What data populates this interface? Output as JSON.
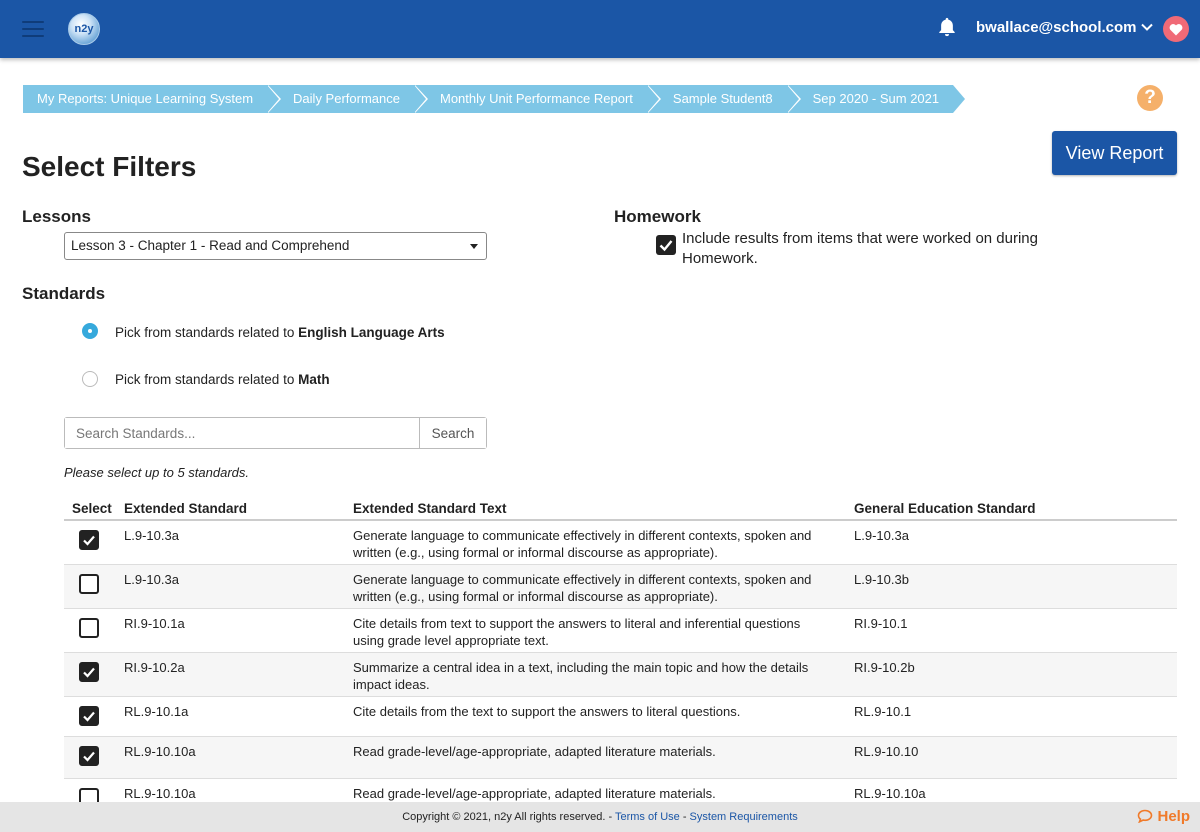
{
  "header": {
    "logo_text": "n2y",
    "user_email": "bwallace@school.com"
  },
  "breadcrumb": [
    "My Reports: Unique Learning System",
    "Daily Performance",
    "Monthly Unit Performance Report",
    "Sample Student8",
    "Sep 2020 - Sum 2021"
  ],
  "help_glyph": "?",
  "page_title": "Select Filters",
  "view_report_label": "View Report",
  "lessons": {
    "heading": "Lessons",
    "selected": "Lesson 3 - Chapter 1 - Read and Comprehend"
  },
  "homework": {
    "heading": "Homework",
    "checked": true,
    "label": "Include results from items that were worked on during Homework."
  },
  "standards": {
    "heading": "Standards",
    "options": [
      {
        "prefix": "Pick from standards related to ",
        "subject": "English Language Arts",
        "selected": true
      },
      {
        "prefix": "Pick from standards related to ",
        "subject": "Math",
        "selected": false
      }
    ],
    "search_placeholder": "Search Standards...",
    "search_button": "Search",
    "hint": "Please select up to 5 standards."
  },
  "table": {
    "headers": [
      "Select",
      "Extended Standard",
      "Extended Standard Text",
      "General Education Standard"
    ],
    "rows": [
      {
        "checked": true,
        "ext": "L.9-10.3a",
        "text": "Generate language to communicate effectively in different contexts, spoken and written (e.g., using formal or informal discourse as appropriate).",
        "gen": "L.9-10.3a"
      },
      {
        "checked": false,
        "ext": "L.9-10.3a",
        "text": "Generate language to communicate effectively in different contexts, spoken and written (e.g., using formal or informal discourse as appropriate).",
        "gen": "L.9-10.3b"
      },
      {
        "checked": false,
        "ext": "RI.9-10.1a",
        "text": "Cite details from text to support the answers to literal and inferential questions using grade level appropriate text.",
        "gen": "RI.9-10.1"
      },
      {
        "checked": true,
        "ext": "RI.9-10.2a",
        "text": "Summarize a central idea in a text, including the main topic and how the details impact ideas.",
        "gen": "RI.9-10.2b"
      },
      {
        "checked": true,
        "ext": "RL.9-10.1a",
        "text": "Cite details from the text to support the answers to literal questions.",
        "gen": "RL.9-10.1"
      },
      {
        "checked": true,
        "ext": "RL.9-10.10a",
        "text": "Read grade-level/age-appropriate, adapted literature materials.",
        "gen": "RL.9-10.10"
      },
      {
        "checked": false,
        "ext": "RL.9-10.10a",
        "text": "Read grade-level/age-appropriate, adapted literature materials.",
        "gen": "RL.9-10.10a"
      }
    ]
  },
  "footer": {
    "copyright": "Copyright © 2021, n2y All rights reserved. - ",
    "terms": "Terms of Use",
    "sep": " - ",
    "sysreq": "System Requirements",
    "help": "Help"
  },
  "colors": {
    "brand_blue": "#1b56a6",
    "breadcrumb": "#7ec6e6",
    "accent_orange": "#f07a2a"
  }
}
